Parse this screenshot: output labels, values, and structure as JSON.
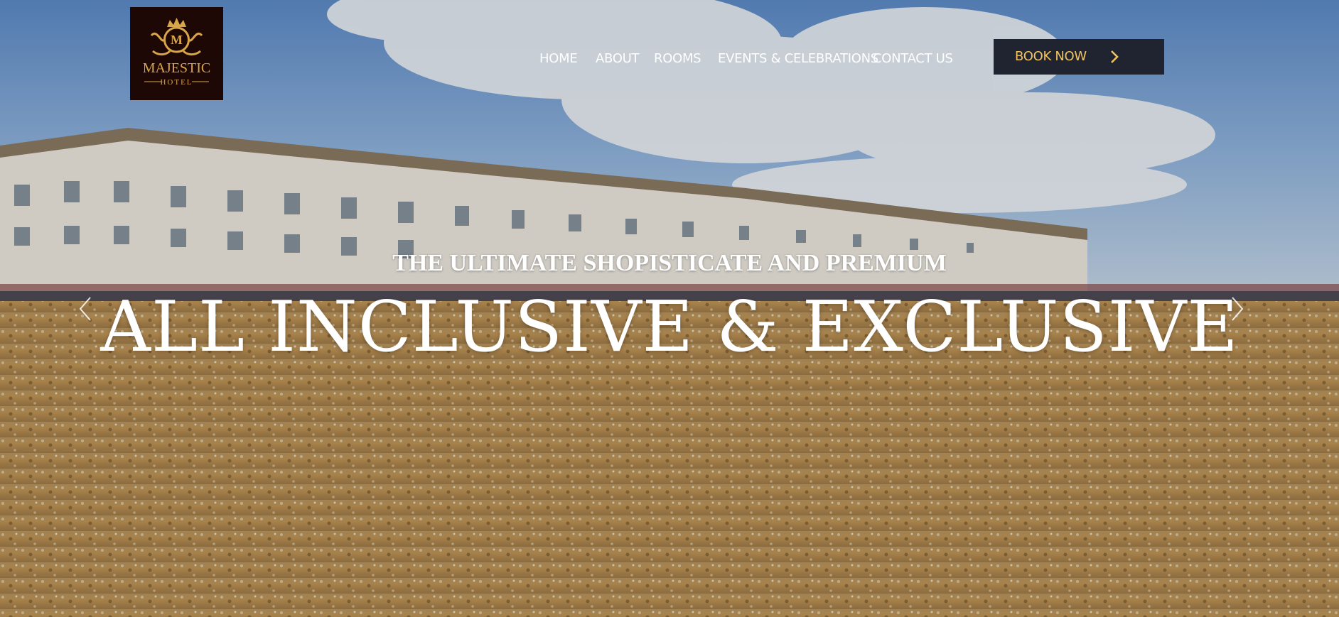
{
  "brand": {
    "logo_lines": [
      "MAJESTIC",
      "HOTEL"
    ],
    "logo_monogram": "M",
    "logo_colors": {
      "background": "#1e0806",
      "gold": "#d8a548"
    }
  },
  "nav": {
    "items": [
      {
        "label": "HOME"
      },
      {
        "label": "ABOUT"
      },
      {
        "label": "ROOMS"
      },
      {
        "label": "EVENTS & CELEBRATIONS"
      },
      {
        "label": "CONTACT US"
      }
    ]
  },
  "cta": {
    "label": "BOOK NOW",
    "icon": "chevron-right-icon",
    "bg_color": "#1f2430",
    "text_color": "#f3c35b"
  },
  "hero": {
    "kicker": "THE ULTIMATE SHOPISTICATE AND PREMIUM",
    "headline": "ALL INCLUSIVE & EXCLUSIVE",
    "prev_icon": "chevron-left-icon",
    "next_icon": "chevron-right-icon",
    "scene": "beach-promenade-photo"
  }
}
